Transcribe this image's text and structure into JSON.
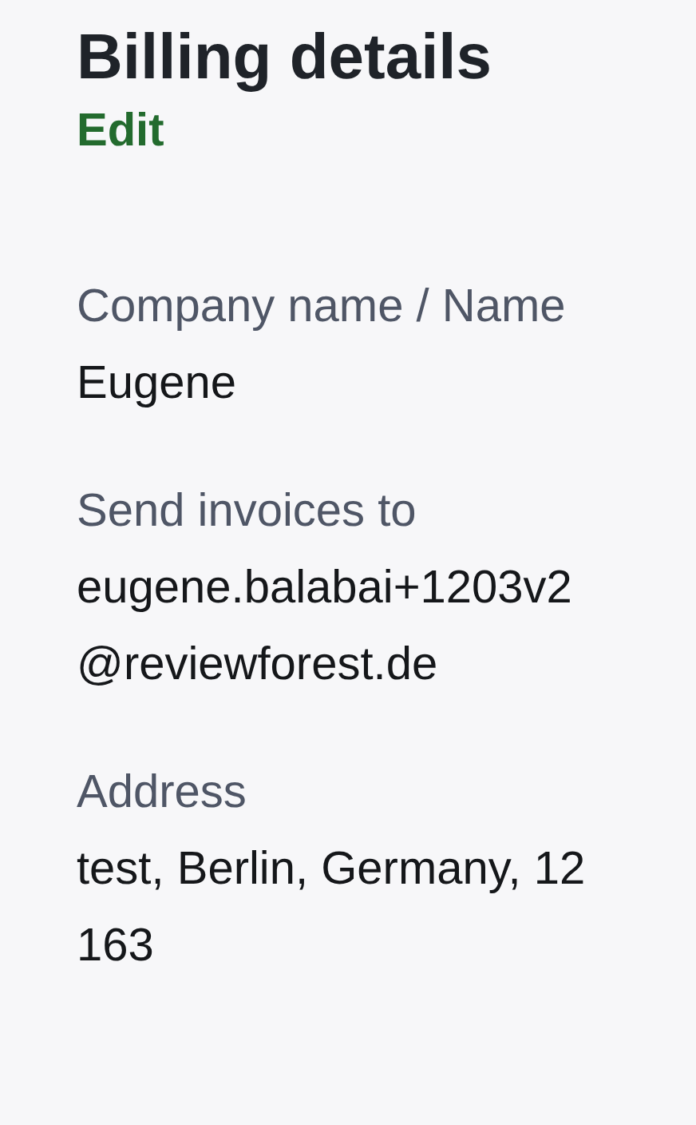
{
  "title": "Billing details",
  "edit_link": "Edit",
  "fields": [
    {
      "label": "Company name / Name",
      "value": "Eugene"
    },
    {
      "label": "Send invoices to",
      "value": "eugene.balabai+1203v2@reviewforest.de"
    },
    {
      "label": "Address",
      "value": "test, Berlin, Germany, 12163"
    }
  ]
}
